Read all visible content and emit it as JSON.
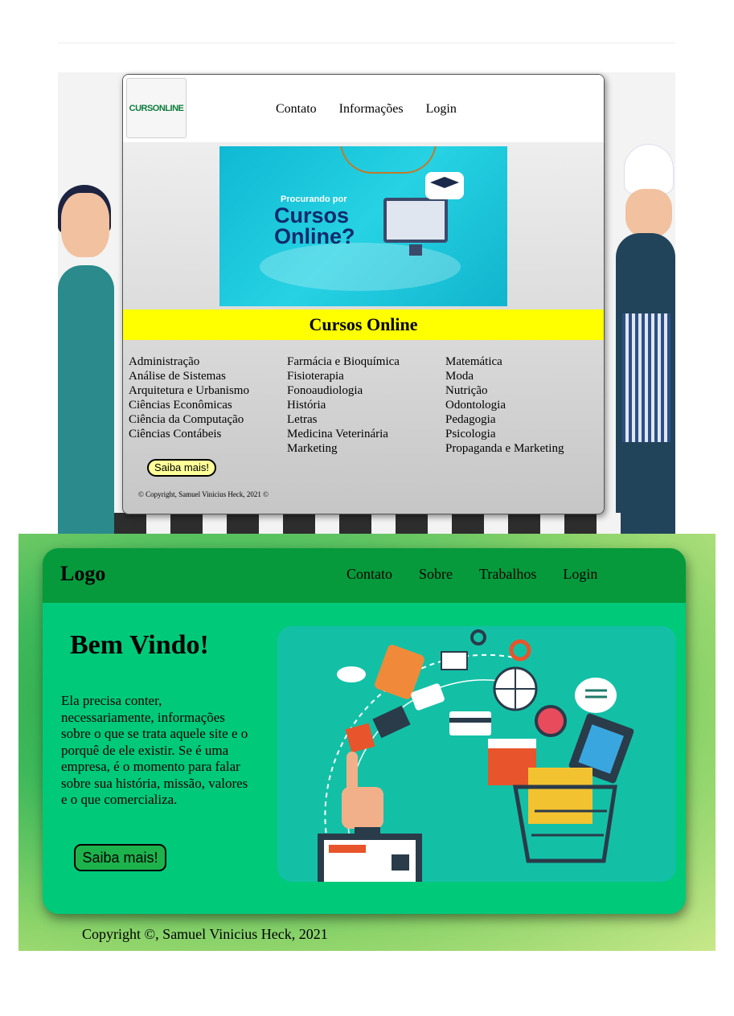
{
  "site1": {
    "logo_text": "CURSONLINE",
    "nav": [
      "Contato",
      "Informações",
      "Login"
    ],
    "banner": {
      "small_text": "Procurando por",
      "big_text": "Cursos Online?"
    },
    "section_title": "Cursos Online",
    "courses": {
      "col1": [
        "Administração",
        "Análise de Sistemas",
        "Arquitetura e Urbanismo",
        "Ciências Econômicas",
        "Ciência da Computação",
        "Ciências Contábeis"
      ],
      "col2": [
        "Farmácia e Bioquímica",
        "Fisioterapia",
        "Fonoaudiologia",
        "História",
        "Letras",
        "Medicina Veterinária",
        "Marketing"
      ],
      "col3": [
        "Matemática",
        "Moda",
        "Nutrição",
        "Odontologia",
        "Pedagogia",
        "Psicologia",
        "Propaganda e Marketing"
      ]
    },
    "button_label": "Saiba mais!",
    "copyright": "© Copyright, Samuel Vinicius Heck, 2021 ©"
  },
  "site2": {
    "logo": "Logo",
    "nav": [
      "Contato",
      "Sobre",
      "Trabalhos",
      "Login"
    ],
    "heading": "Bem Vindo!",
    "paragraph": "Ela precisa conter, necessariamente, informações sobre o que se trata aquele site e o porquê de ele existir. Se é uma empresa, é o momento para falar sobre sua história, missão, valores e o que comercializa.",
    "button_label": "Saiba mais!",
    "copyright": "Copyright ©, Samuel Vinicius Heck, 2021"
  },
  "colors": {
    "yellow_bar": "#ffff00",
    "button1_fill": "#ffff99",
    "header2": "#069a3c",
    "card2": "#00c97a",
    "button2_fill": "#1cb34d"
  }
}
